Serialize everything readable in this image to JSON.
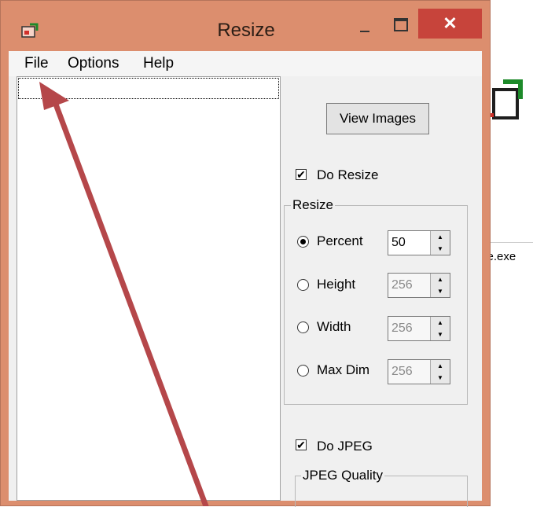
{
  "window": {
    "title": "Resize",
    "close_glyph": "✕",
    "accent": "#dc8e6e",
    "close_color": "#c7443b"
  },
  "menu": {
    "items": [
      "File",
      "Options",
      "Help"
    ]
  },
  "controls": {
    "view_button": "View Images",
    "do_resize": {
      "label": "Do Resize",
      "checked": true
    },
    "resize_group": {
      "legend": "Resize",
      "options": [
        {
          "label": "Percent",
          "value": "50",
          "selected": true,
          "enabled": true
        },
        {
          "label": "Height",
          "value": "256",
          "selected": false,
          "enabled": false
        },
        {
          "label": "Width",
          "value": "256",
          "selected": false,
          "enabled": false
        },
        {
          "label": "Max Dim",
          "value": "256",
          "selected": false,
          "enabled": false
        }
      ]
    },
    "do_jpeg": {
      "label": "Do JPEG",
      "checked": true
    },
    "jpeg_group": {
      "legend": "JPEG Quality"
    }
  },
  "background": {
    "exe_label": "ze.exe"
  },
  "icons": {
    "window_icon": "app-icon",
    "check": "✔",
    "spin_up": "▲",
    "spin_down": "▼"
  }
}
